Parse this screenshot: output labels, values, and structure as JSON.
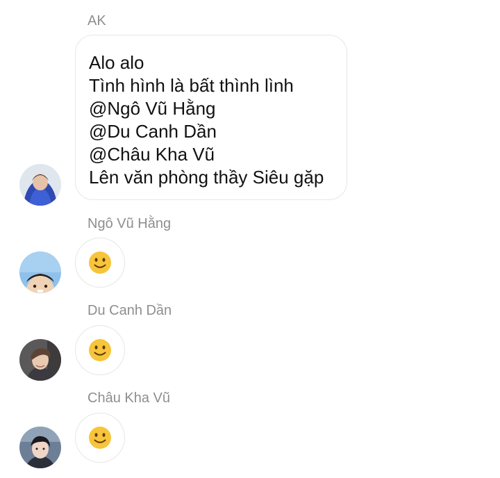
{
  "messages": [
    {
      "sender": "AK",
      "lines": [
        "Alo alo",
        "Tình hình là bất thình lình",
        "@Ngô Vũ Hằng",
        "@Du Canh Dần",
        "@Châu Kha Vũ",
        "Lên văn phòng thầy Siêu gặp"
      ]
    },
    {
      "sender": "Ngô Vũ Hằng",
      "content": "slightly-smiling-face-emoji"
    },
    {
      "sender": "Du Canh Dần",
      "content": "slightly-smiling-face-emoji"
    },
    {
      "sender": "Châu Kha Vũ",
      "content": "slightly-smiling-face-emoji"
    }
  ],
  "colors": {
    "sender_name": "#8e8e8e",
    "bubble_border": "#e6e6e6",
    "emoji_face": "#f7c43a"
  }
}
